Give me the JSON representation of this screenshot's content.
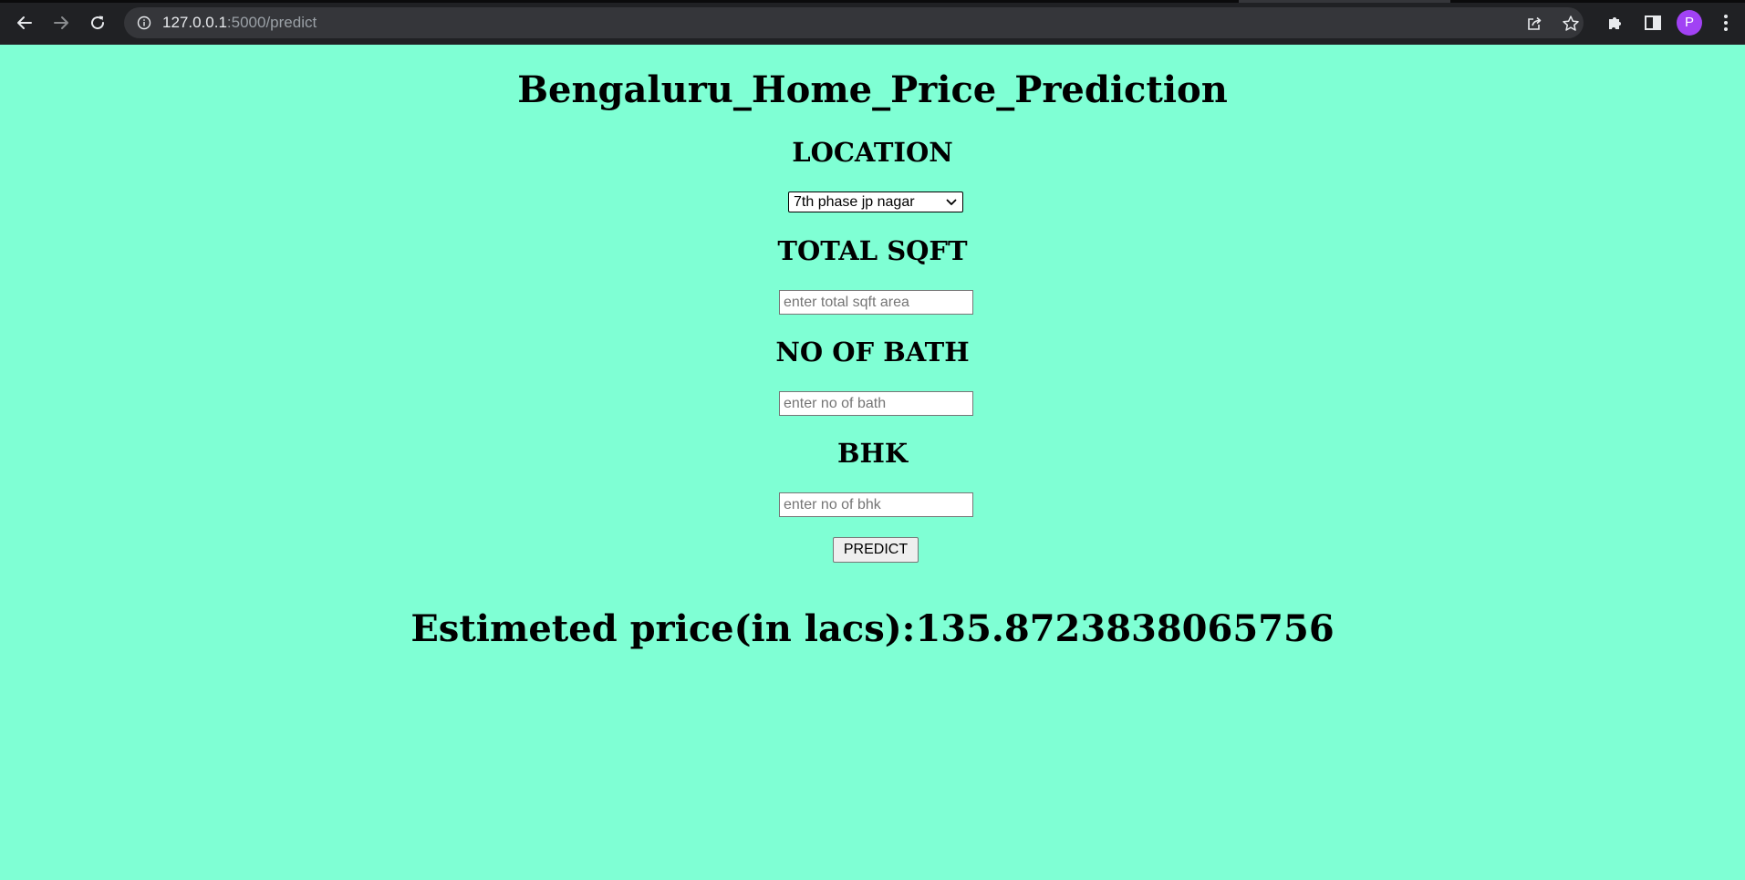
{
  "browser": {
    "url_host": "127.0.0.1",
    "url_path": ":5000/predict",
    "profile_initial": "P"
  },
  "page": {
    "title": "Bengaluru_Home_Price_Prediction",
    "background_color": "#7fffd4",
    "location": {
      "heading": "LOCATION",
      "selected_option": "7th phase jp nagar"
    },
    "total_sqft": {
      "heading": "TOTAL SQFT",
      "value": "",
      "placeholder": "enter total sqft area"
    },
    "bath": {
      "heading": "NO OF BATH",
      "value": "",
      "placeholder": "enter no of bath"
    },
    "bhk": {
      "heading": "BHK",
      "value": "",
      "placeholder": "enter no of bhk"
    },
    "predict_label": "PREDICT",
    "result_text": "Estimeted price(in lacs):135.8723838065756"
  },
  "icons": {
    "back": "arrow-left-icon",
    "forward": "arrow-right-icon",
    "reload": "reload-icon",
    "site_info": "info-icon",
    "share": "share-icon",
    "bookmark": "star-icon",
    "extensions": "puzzle-icon",
    "side_panel": "side-panel-icon",
    "menu": "kebab-menu-icon",
    "dropdown": "chevron-down-icon"
  }
}
